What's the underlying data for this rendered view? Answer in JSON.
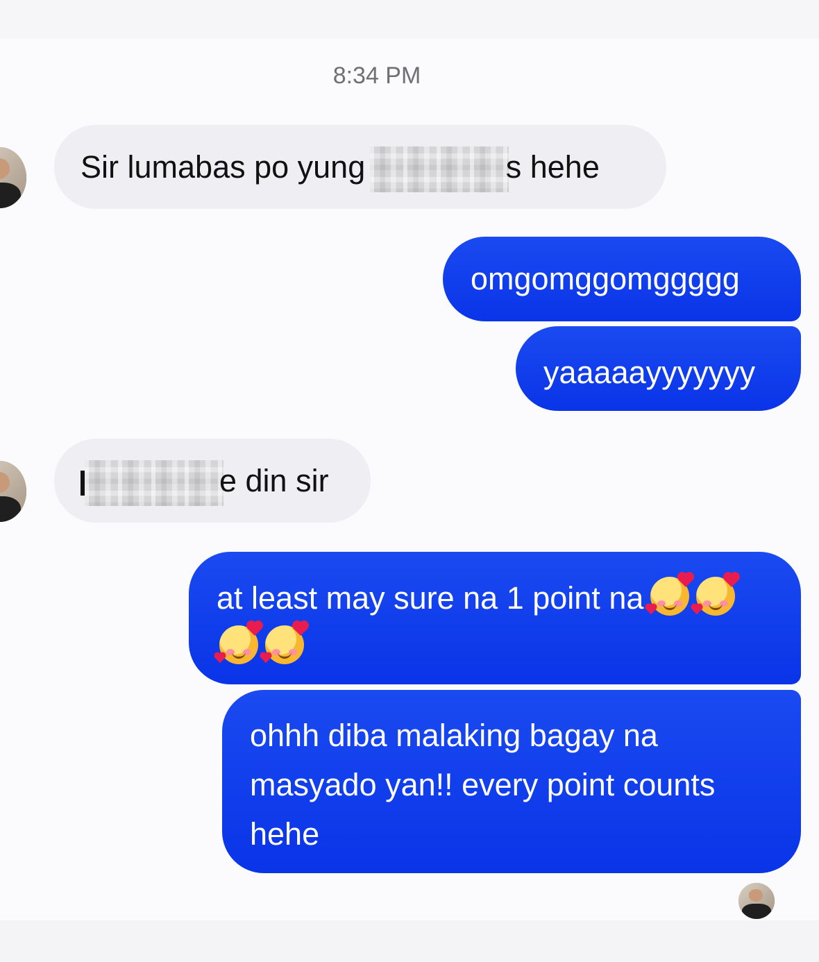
{
  "conversation": {
    "timestamp": "8:34 PM",
    "messages": [
      {
        "sender": "contact",
        "text_before": "Sir lumabas po yung ",
        "redacted": true,
        "text_after": "s hehe"
      },
      {
        "sender": "me",
        "text": "omgomggomggggg"
      },
      {
        "sender": "me",
        "text": "yaaaaayyyyyyy"
      },
      {
        "sender": "contact",
        "text_before": "",
        "redacted": true,
        "text_after": "e din sir"
      },
      {
        "sender": "me",
        "line1": "at least may sure na 1 point na",
        "emoji": "smiling-face-with-hearts"
      },
      {
        "sender": "me",
        "lines": [
          "ohhh diba malaking bagay na",
          "masyado yan!! every point counts",
          "hehe"
        ]
      }
    ]
  },
  "colors": {
    "outgoing_bubble": "#0a34e8",
    "incoming_bubble": "#efeff3",
    "background": "#fbfbfd"
  }
}
